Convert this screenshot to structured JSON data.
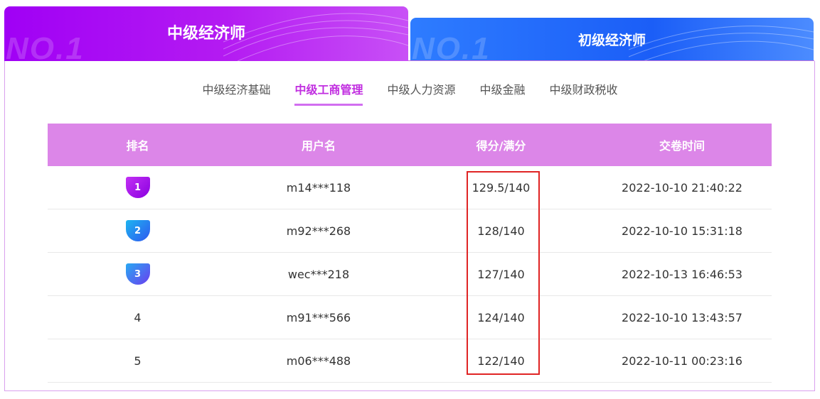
{
  "top_tabs": [
    {
      "label": "中级经济师",
      "watermark": "NO.1",
      "active": true
    },
    {
      "label": "初级经济师",
      "watermark": "NO.1",
      "active": false
    }
  ],
  "subtabs": [
    {
      "label": "中级经济基础",
      "active": false
    },
    {
      "label": "中级工商管理",
      "active": true
    },
    {
      "label": "中级人力资源",
      "active": false
    },
    {
      "label": "中级金融",
      "active": false
    },
    {
      "label": "中级财政税收",
      "active": false
    }
  ],
  "table": {
    "headers": [
      "排名",
      "用户名",
      "得分/满分",
      "交卷时间"
    ],
    "rows": [
      {
        "rank": "1",
        "user": "m14***118",
        "score": "129.5/140",
        "time": "2022-10-10 21:40:22"
      },
      {
        "rank": "2",
        "user": "m92***268",
        "score": "128/140",
        "time": "2022-10-10 15:31:18"
      },
      {
        "rank": "3",
        "user": "wec***218",
        "score": "127/140",
        "time": "2022-10-13 16:46:53"
      },
      {
        "rank": "4",
        "user": "m91***566",
        "score": "124/140",
        "time": "2022-10-10 13:43:57"
      },
      {
        "rank": "5",
        "user": "m06***488",
        "score": "122/140",
        "time": "2022-10-11 00:23:16"
      }
    ]
  },
  "colors": {
    "primary_tab": "#a000f5",
    "secondary_tab": "#2e7cff",
    "header_bg": "#dc86e8",
    "active_subtab": "#c12ee0",
    "highlight": "#e02424"
  }
}
